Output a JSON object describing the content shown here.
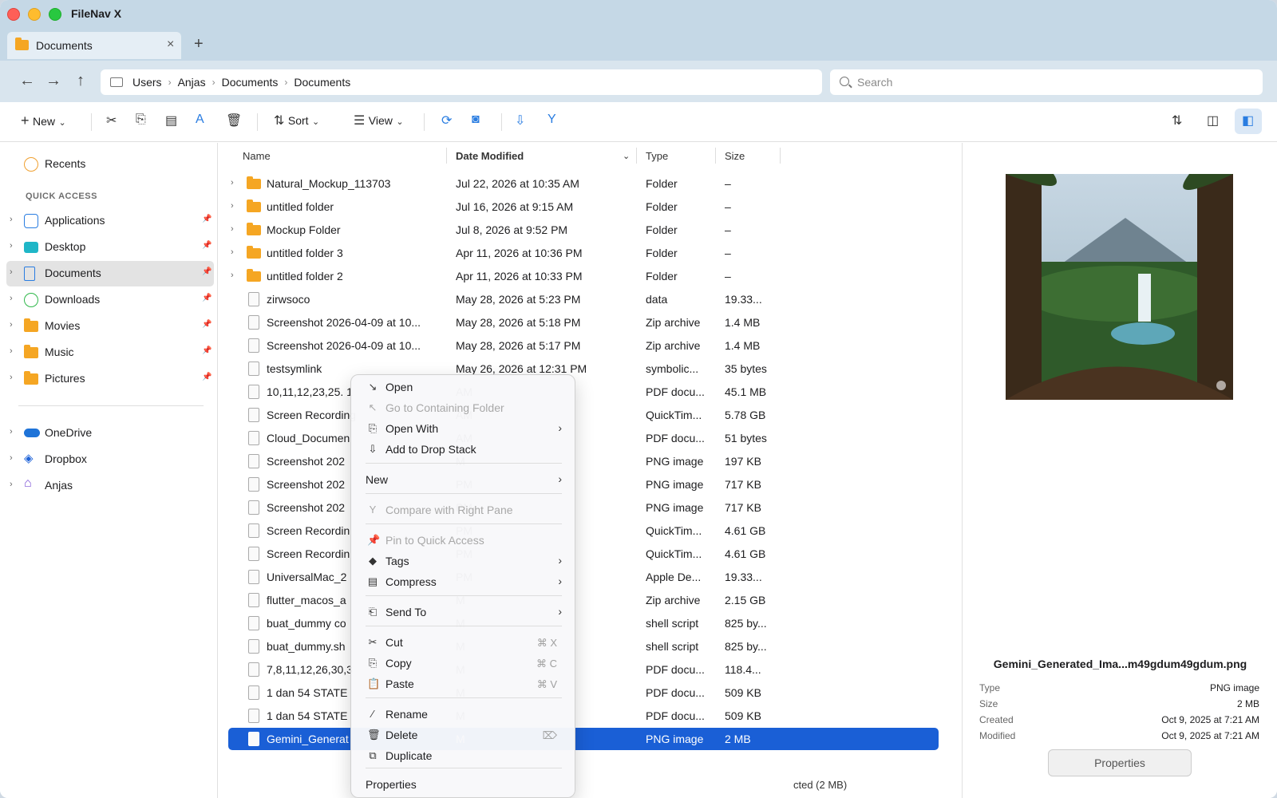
{
  "app": {
    "title": "FileNav X"
  },
  "tab": {
    "label": "Documents",
    "close": "×",
    "add": "+"
  },
  "nav": {
    "back": "←",
    "forward": "→",
    "up": "↑"
  },
  "breadcrumb": [
    "Users",
    "Anjas",
    "Documents",
    "Documents"
  ],
  "search": {
    "placeholder": "Search"
  },
  "toolbar": {
    "new_label": "New",
    "sort_label": "Sort",
    "view_label": "View",
    "icons": [
      "scissors-icon",
      "copy-icon",
      "paste-icon",
      "rename-icon",
      "trash-icon",
      "sort-icon",
      "view-list-icon",
      "refresh-icon",
      "camera-icon",
      "drop-stack-icon",
      "compare-icon",
      "sync-icon",
      "split-pane-icon",
      "preview-pane-icon"
    ]
  },
  "sidebar": {
    "recents": "Recents",
    "quick_access_header": "QUICK ACCESS",
    "quick_access": [
      {
        "label": "Applications",
        "icon": "applications-icon"
      },
      {
        "label": "Desktop",
        "icon": "desktop-icon"
      },
      {
        "label": "Documents",
        "icon": "documents-icon"
      },
      {
        "label": "Downloads",
        "icon": "downloads-icon"
      },
      {
        "label": "Movies",
        "icon": "folder-icon"
      },
      {
        "label": "Music",
        "icon": "folder-icon"
      },
      {
        "label": "Pictures",
        "icon": "folder-icon"
      }
    ],
    "locations": [
      {
        "label": "OneDrive",
        "icon": "onedrive-icon"
      },
      {
        "label": "Dropbox",
        "icon": "dropbox-icon"
      },
      {
        "label": "Anjas",
        "icon": "home-icon"
      }
    ]
  },
  "columns": {
    "name": "Name",
    "date": "Date Modified",
    "type": "Type",
    "size": "Size"
  },
  "files": [
    {
      "name": "Natural_Mockup_113703",
      "date": "Jul 22, 2026 at 10:35 AM",
      "type": "Folder",
      "size": "–"
    },
    {
      "name": "untitled folder",
      "date": "Jul 16, 2026 at 9:15 AM",
      "type": "Folder",
      "size": "–"
    },
    {
      "name": "Mockup Folder",
      "date": "Jul 8, 2026 at 9:52 PM",
      "type": "Folder",
      "size": "–"
    },
    {
      "name": "untitled folder 3",
      "date": "Apr 11, 2026 at 10:36 PM",
      "type": "Folder",
      "size": "–"
    },
    {
      "name": "untitled folder 2",
      "date": "Apr 11, 2026 at 10:33 PM",
      "type": "Folder",
      "size": "–"
    },
    {
      "name": "zirwsoco",
      "date": "May 28, 2026 at 5:23 PM",
      "type": "data",
      "size": "19.33..."
    },
    {
      "name": "Screenshot 2026-04-09 at 10...",
      "date": "May 28, 2026 at 5:18 PM",
      "type": "Zip archive",
      "size": "1.4 MB"
    },
    {
      "name": "Screenshot 2026-04-09 at 10...",
      "date": "May 28, 2026 at 5:17 PM",
      "type": "Zip archive",
      "size": "1.4 MB"
    },
    {
      "name": "testsymlink",
      "date": "May 26, 2026 at 12:31 PM",
      "type": "symbolic...",
      "size": "35 bytes"
    },
    {
      "name": "10,11,12,23,25. 1",
      "date": "AM",
      "type": "PDF docu...",
      "size": "45.1 MB"
    },
    {
      "name": "Screen Recording",
      "date": "AM",
      "type": "QuickTim...",
      "size": "5.78 GB"
    },
    {
      "name": "Cloud_Documen",
      "date": "AM",
      "type": "PDF docu...",
      "size": "51 bytes"
    },
    {
      "name": "Screenshot 202",
      "date": "M",
      "type": "PNG image",
      "size": "197 KB"
    },
    {
      "name": "Screenshot 202",
      "date": "PM",
      "type": "PNG image",
      "size": "717 KB"
    },
    {
      "name": "Screenshot 202",
      "date": "PM",
      "type": "PNG image",
      "size": "717 KB"
    },
    {
      "name": "Screen Recordin",
      "date": "PM",
      "type": "QuickTim...",
      "size": "4.61 GB"
    },
    {
      "name": "Screen Recordin",
      "date": "PM",
      "type": "QuickTim...",
      "size": "4.61 GB"
    },
    {
      "name": "UniversalMac_2",
      "date": "PM",
      "type": "Apple De...",
      "size": "19.33..."
    },
    {
      "name": "flutter_macos_a",
      "date": "M",
      "type": "Zip archive",
      "size": "2.15 GB"
    },
    {
      "name": "buat_dummy co",
      "date": "M",
      "type": "shell script",
      "size": "825 by..."
    },
    {
      "name": "buat_dummy.sh",
      "date": "M",
      "type": "shell script",
      "size": "825 by..."
    },
    {
      "name": "7,8,11,12,26,30,3",
      "date": "M",
      "type": "PDF docu...",
      "size": "118.4..."
    },
    {
      "name": "1 dan 54 STATE",
      "date": "M",
      "type": "PDF docu...",
      "size": "509 KB"
    },
    {
      "name": "1 dan 54 STATE",
      "date": "M",
      "type": "PDF docu...",
      "size": "509 KB"
    },
    {
      "name": "Gemini_Generat",
      "date": "M",
      "type": "PNG image",
      "size": "2 MB"
    }
  ],
  "status": "cted (2 MB)",
  "preview": {
    "name": "Gemini_Generated_Ima...m49gdum49gdum.png",
    "type_key": "Type",
    "type_val": "PNG image",
    "size_key": "Size",
    "size_val": "2 MB",
    "created_key": "Created",
    "created_val": "Oct 9, 2025 at 7:21 AM",
    "modified_key": "Modified",
    "modified_val": "Oct 9, 2025 at 7:21 AM",
    "properties_button": "Properties"
  },
  "context_menu": [
    {
      "label": "Open",
      "icon": "↘",
      "disabled": false
    },
    {
      "label": "Go to Containing Folder",
      "icon": "↖",
      "disabled": true
    },
    {
      "label": "Open With",
      "icon": "⎘",
      "disabled": false,
      "submenu": true
    },
    {
      "label": "Add to Drop Stack",
      "icon": "⇩",
      "disabled": false
    },
    {
      "label": "New",
      "icon": "",
      "disabled": false,
      "submenu": true
    },
    {
      "label": "Compare with Right Pane",
      "icon": "Y",
      "disabled": true
    },
    {
      "label": "Pin to Quick Access",
      "icon": "📌",
      "disabled": true
    },
    {
      "label": "Tags",
      "icon": "◆",
      "disabled": false,
      "submenu": true
    },
    {
      "label": "Compress",
      "icon": "▤",
      "disabled": false,
      "submenu": true
    },
    {
      "label": "Send To",
      "icon": "⎗",
      "disabled": false,
      "submenu": true
    },
    {
      "label": "Cut",
      "icon": "✂",
      "disabled": false,
      "shortcut": "⌘ X"
    },
    {
      "label": "Copy",
      "icon": "⎘",
      "disabled": false,
      "shortcut": "⌘ C"
    },
    {
      "label": "Paste",
      "icon": "📋",
      "disabled": false,
      "shortcut": "⌘ V"
    },
    {
      "label": "Rename",
      "icon": "∕",
      "disabled": false
    },
    {
      "label": "Delete",
      "icon": "🗑",
      "disabled": false,
      "shortcut": "⌦"
    },
    {
      "label": "Duplicate",
      "icon": "⧉",
      "disabled": false
    },
    {
      "label": "Properties",
      "icon": "",
      "disabled": false
    }
  ],
  "colors": {
    "accent": "#1a5fd6",
    "titlebar": "#c5d8e6",
    "folder": "#f5a623"
  }
}
